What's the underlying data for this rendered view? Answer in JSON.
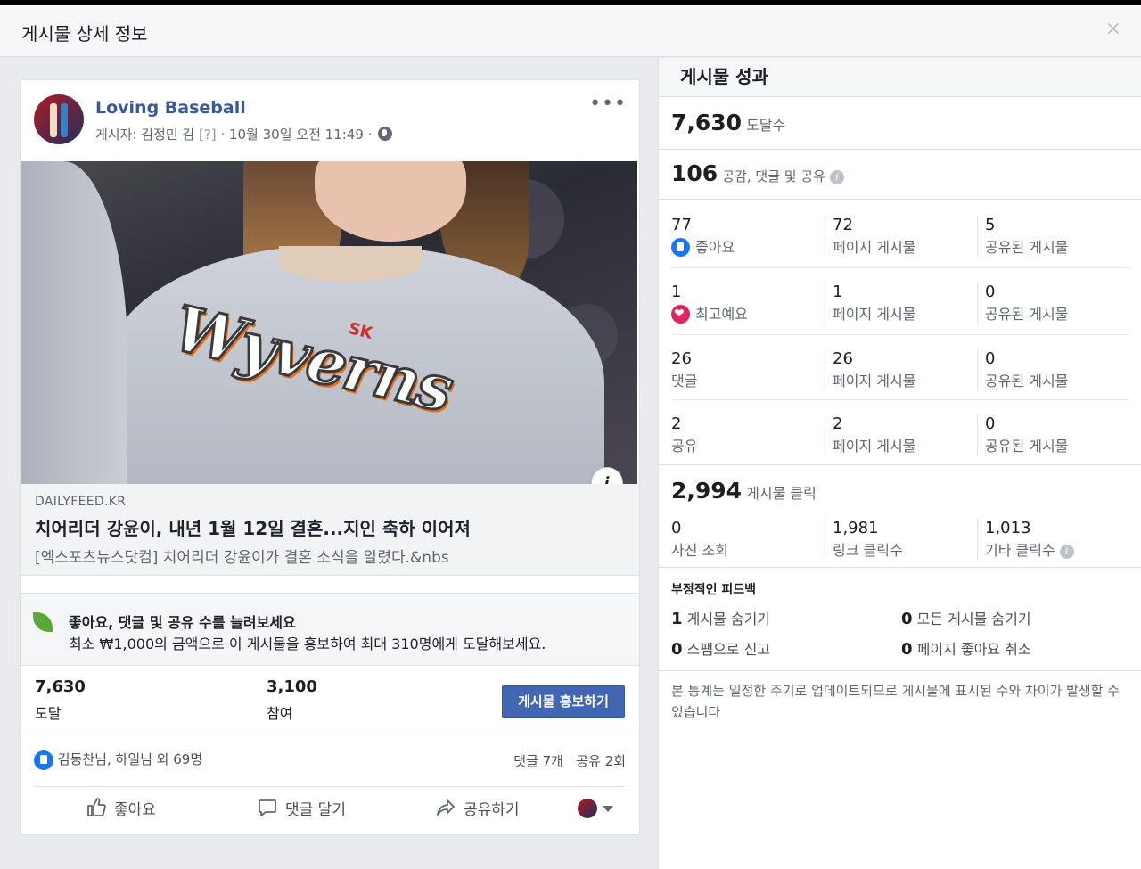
{
  "dialog": {
    "title": "게시물 상세 정보",
    "close": "×"
  },
  "post": {
    "page_name": "Loving Baseball",
    "byline_prefix": "게시자: 김정민 김",
    "byline_q": "[?]",
    "byline_time": "· 10월 30일 오전 11:49 ·",
    "more": "•••",
    "image_text": "Wyverns",
    "image_sk": "SK",
    "info_btn": "i",
    "link": {
      "domain": "DAILYFEED.KR",
      "headline": "치어리더 강윤이, 내년 1월 12일 결혼...지인 축하 이어져",
      "description": "[엑스포츠뉴스닷컴] 치어리더 강윤이가 결혼 소식을 알렸다.&nbs"
    },
    "boost": {
      "title": "좋아요, 댓글 및 공유 수를 늘려보세요",
      "text": "최소 ₩1,000의 금액으로 이 게시물을 홍보하여 최대 310명에게 도달해보세요."
    },
    "stats": {
      "reach_value": "7,630",
      "reach_label": "도달",
      "engage_value": "3,100",
      "engage_label": "참여",
      "promote_button": "게시물 홍보하기"
    },
    "social": {
      "who": "김동찬님, 하일님 외 69명",
      "counts": "댓글 7개   공유 2회"
    },
    "actions": {
      "like": "좋아요",
      "comment": "댓글 달기",
      "share": "공유하기"
    }
  },
  "performance": {
    "title": "게시물 성과",
    "reach": {
      "value": "7,630",
      "label": "도달수"
    },
    "engagement": {
      "value": "106",
      "label": "공감, 댓글 및 공유"
    },
    "rows": [
      {
        "n1": "77",
        "l1": "좋아요",
        "n2": "72",
        "l2": "페이지 게시물",
        "n3": "5",
        "l3": "공유된 게시물"
      },
      {
        "n1": "1",
        "l1": "최고예요",
        "n2": "1",
        "l2": "페이지 게시물",
        "n3": "0",
        "l3": "공유된 게시물"
      },
      {
        "n1": "26",
        "l1": "댓글",
        "n2": "26",
        "l2": "페이지 게시물",
        "n3": "0",
        "l3": "공유된 게시물"
      },
      {
        "n1": "2",
        "l1": "공유",
        "n2": "2",
        "l2": "페이지 게시물",
        "n3": "0",
        "l3": "공유된 게시물"
      }
    ],
    "clicks": {
      "value": "2,994",
      "label": "게시물 클릭"
    },
    "click_cells": [
      {
        "n": "0",
        "l": "사진 조회"
      },
      {
        "n": "1,981",
        "l": "링크 클릭수"
      },
      {
        "n": "1,013",
        "l": "기타 클릭수"
      }
    ],
    "negative": {
      "title": "부정적인 피드백",
      "items": [
        {
          "n": "1",
          "l": "게시물 숨기기"
        },
        {
          "n": "0",
          "l": "모든 게시물 숨기기"
        },
        {
          "n": "0",
          "l": "스팸으로 신고"
        },
        {
          "n": "0",
          "l": "페이지 좋아요 취소"
        }
      ]
    },
    "note": "본 통계는 일정한 주기로 업데이트되므로 게시물에 표시된 수와 차이가 발생할 수 있습니다"
  },
  "colors": {
    "brand": "#4267b2",
    "link": "#385898",
    "like": "#1877f2",
    "love": "#e0245e"
  }
}
